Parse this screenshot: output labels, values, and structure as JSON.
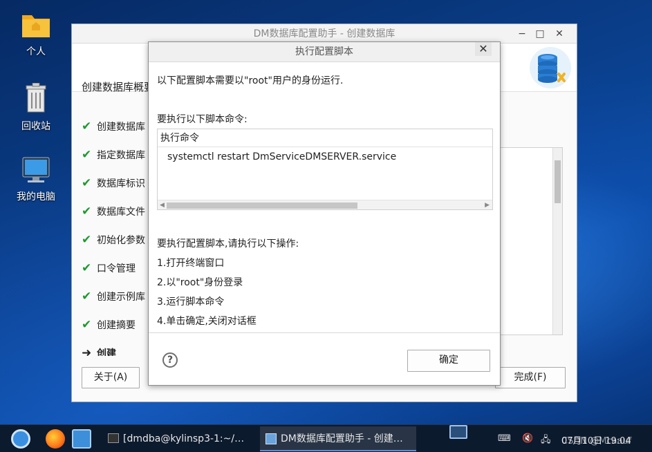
{
  "desktop": {
    "icons": [
      {
        "label": "个人"
      },
      {
        "label": "回收站"
      },
      {
        "label": "我的电脑"
      }
    ]
  },
  "main_window": {
    "title": "DM数据库配置助手 - 创建数据库",
    "controls": {
      "minimize": "−",
      "maximize": "□",
      "close": "✕"
    },
    "summary_title": "创建数据库概要",
    "steps": [
      {
        "label": "创建数据库",
        "done": true
      },
      {
        "label": "指定数据库",
        "done": true
      },
      {
        "label": "数据库标识",
        "done": true
      },
      {
        "label": "数据库文件",
        "done": true
      },
      {
        "label": "初始化参数",
        "done": true
      },
      {
        "label": "口令管理",
        "done": true
      },
      {
        "label": "创建示例库",
        "done": true
      },
      {
        "label": "创建摘要",
        "done": true
      },
      {
        "label": "创建",
        "done": false,
        "current": true
      }
    ],
    "about_button": "关于(A)",
    "finish_button": "完成(F)"
  },
  "dialog": {
    "title": "执行配置脚本",
    "close": "✕",
    "intro": "以下配置脚本需要以\"root\"用户的身份运行.",
    "commands_heading": "要执行以下脚本命令:",
    "table_header": "执行命令",
    "commands": [
      "systemctl restart DmServiceDMSERVER.service"
    ],
    "steps_heading": "要执行配置脚本,请执行以下操作:",
    "instructions": [
      "1.打开终端窗口",
      "2.以\"root\"身份登录",
      "3.运行脚本命令",
      "4.单击确定,关闭对话框"
    ],
    "ok_button": "确定",
    "help_icon": "?"
  },
  "taskbar": {
    "tasks": [
      {
        "label": "[dmdba@kylinsp3-1:~/…",
        "active": false
      },
      {
        "label": "DM数据库配置助手 - 创建…",
        "active": true
      }
    ],
    "clock": "07月10日 19:04",
    "watermark": "CSDN @Mcaauf"
  },
  "colors": {
    "check": "#1d9a2f",
    "taskbar_bg": "#0c1a2e",
    "desktop_bg": "#0a3f8c"
  }
}
